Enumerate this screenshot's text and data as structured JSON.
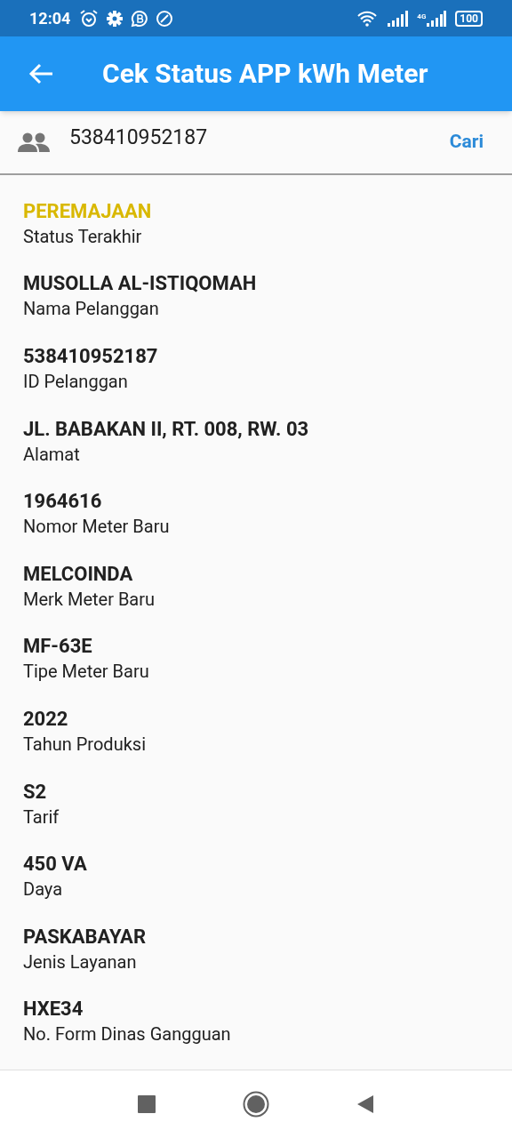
{
  "status_bar": {
    "time": "12:04",
    "network": "4G",
    "battery": "100"
  },
  "app_bar": {
    "title": "Cek Status APP kWh Meter"
  },
  "search": {
    "value": "538410952187",
    "button": "Cari"
  },
  "details": [
    {
      "kind": "status",
      "value": "PEREMAJAAN",
      "label": "Status Terakhir"
    },
    {
      "kind": "field",
      "value": "MUSOLLA AL-ISTIQOMAH",
      "label": "Nama Pelanggan"
    },
    {
      "kind": "field",
      "value": "538410952187",
      "label": "ID Pelanggan"
    },
    {
      "kind": "field",
      "value": "JL. BABAKAN II, RT. 008, RW. 03",
      "label": "Alamat"
    },
    {
      "kind": "field",
      "value": "1964616",
      "label": "Nomor Meter Baru"
    },
    {
      "kind": "field",
      "value": "MELCOINDA",
      "label": "Merk Meter Baru"
    },
    {
      "kind": "field",
      "value": "MF-63E",
      "label": "Tipe Meter Baru"
    },
    {
      "kind": "field",
      "value": "2022",
      "label": "Tahun Produksi"
    },
    {
      "kind": "field",
      "value": "S2",
      "label": "Tarif"
    },
    {
      "kind": "field",
      "value": "450 VA",
      "label": "Daya"
    },
    {
      "kind": "field",
      "value": "PASKABAYAR",
      "label": "Jenis Layanan"
    },
    {
      "kind": "field",
      "value": "HXE34",
      "label": "No. Form Dinas Gangguan"
    }
  ]
}
